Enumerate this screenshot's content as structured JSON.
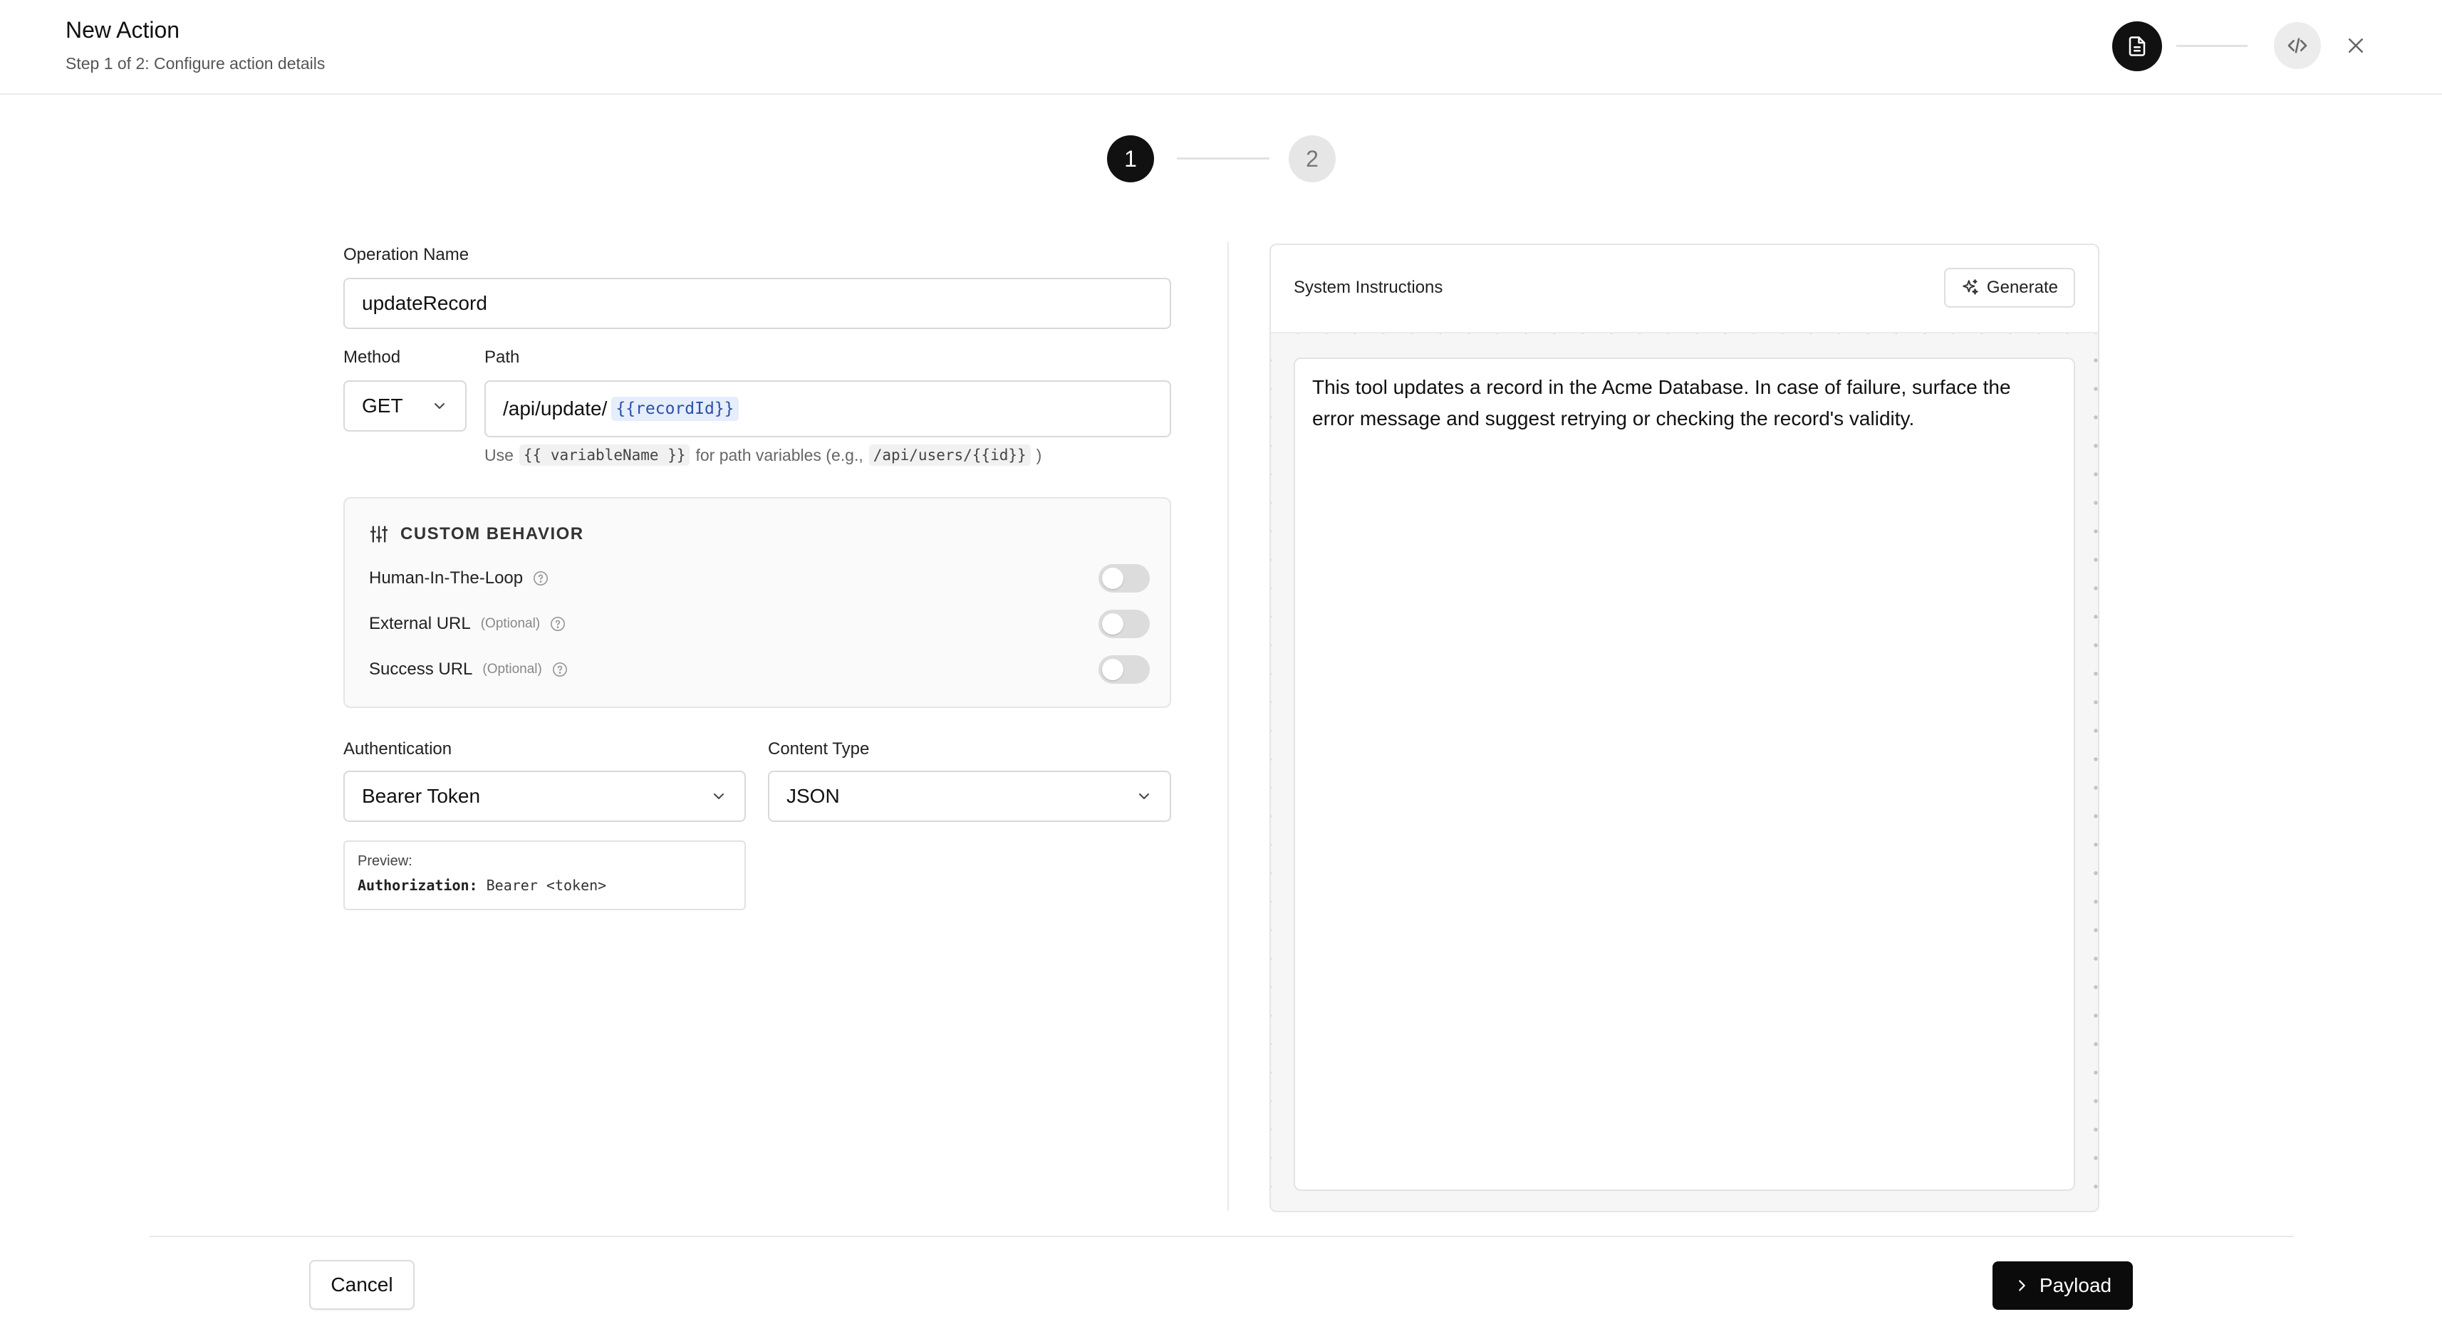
{
  "header": {
    "title": "New Action",
    "subtitle": "Step 1 of 2: Configure action details"
  },
  "stepper": {
    "steps": [
      "1",
      "2"
    ],
    "current": 1
  },
  "form": {
    "operation_name": {
      "label": "Operation Name",
      "value": "updateRecord"
    },
    "method": {
      "label": "Method",
      "value": "GET"
    },
    "path": {
      "label": "Path",
      "value_prefix": "/api/update/",
      "variable": "{{recordId}}",
      "hint_use": "Use",
      "hint_var_code": "{{ variableName }}",
      "hint_middle": "for path variables (e.g.,",
      "hint_example_code": "/api/users/{{id}}",
      "hint_end": ")"
    },
    "custom_behavior": {
      "title": "CUSTOM BEHAVIOR",
      "items": [
        {
          "label": "Human-In-The-Loop",
          "optional": "",
          "enabled": false
        },
        {
          "label": "External URL",
          "optional": "(Optional)",
          "enabled": false
        },
        {
          "label": "Success URL",
          "optional": "(Optional)",
          "enabled": false
        }
      ]
    },
    "authentication": {
      "label": "Authentication",
      "value": "Bearer Token"
    },
    "content_type": {
      "label": "Content Type",
      "value": "JSON"
    },
    "preview": {
      "label": "Preview:",
      "header_key": "Authorization:",
      "header_value": "Bearer <token>"
    }
  },
  "system_instructions": {
    "title": "System Instructions",
    "generate_label": "Generate",
    "text": "This tool updates a record in the Acme Database. In case of failure, surface the error message and suggest retrying or checking the record's validity."
  },
  "footer": {
    "cancel_label": "Cancel",
    "payload_label": "Payload"
  },
  "colors": {
    "accent": "#0b0b0b",
    "chip_text": "#2b4fa8",
    "chip_bg": "#e6edfb",
    "toggle_off": "#dcdcdc"
  }
}
